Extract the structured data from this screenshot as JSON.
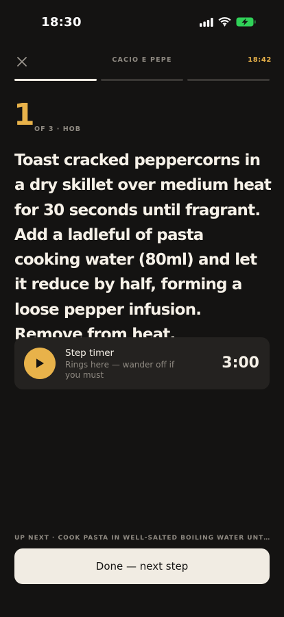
{
  "status_bar": {
    "time": "18:30",
    "icons": [
      "signal-icon",
      "wifi-icon",
      "battery-charging-icon"
    ],
    "battery_color": "#30d158"
  },
  "header": {
    "close_icon": "close-icon",
    "recipe_title": "CACIO E PEPE",
    "clock": "18:42"
  },
  "progress": {
    "total_steps": 3,
    "current_step": 1
  },
  "step": {
    "number": "1",
    "meta": "OF 3 · HOB",
    "instruction": "Toast cracked peppercorns in a dry skillet over medium heat for 30 seconds until fragrant. Add a ladleful of pasta cooking water (80ml) and let it reduce by half, forming a loose pepper infusion. Remove from heat."
  },
  "timer": {
    "title": "Step timer",
    "subtitle": "Rings here — wander off if you must",
    "value": "3:00",
    "play_icon": "play-icon"
  },
  "footer": {
    "up_next": "UP NEXT · COOK PASTA IN WELL-SALTED BOILING WATER UNTIL AL DENTE",
    "done_label": "Done — next step"
  },
  "colors": {
    "background": "#141312",
    "accent": "#e8b24a",
    "text": "#f6f1e8",
    "muted": "#8f8a82",
    "card": "#242220",
    "button": "#f1ece3"
  }
}
